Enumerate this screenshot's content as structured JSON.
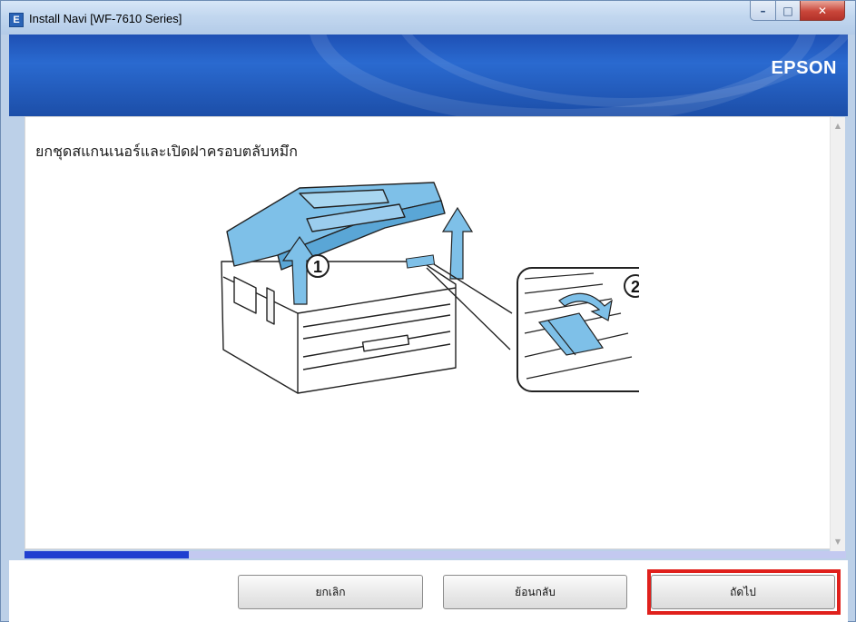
{
  "window": {
    "title": "Install Navi [WF-7610 Series]",
    "app_icon_letter": "E",
    "controls": {
      "minimize": "–",
      "maximize": "□",
      "close": "✕"
    }
  },
  "header": {
    "brand": "EPSON"
  },
  "content": {
    "instruction": "ยกชุดสแกนเนอร์และเปิดฝาครอบตลับหมึก",
    "illustration": {
      "step_1": "1",
      "step_2": "2"
    }
  },
  "progress": {
    "fraction": 0.2
  },
  "footer": {
    "cancel_label": "ยกเลิก",
    "back_label": "ย้อนกลับ",
    "next_label": "ถัดไป"
  },
  "colors": {
    "header_blue": "#1e50b4",
    "progress_fill": "#1f3fd0",
    "progress_track": "#c3c9f0",
    "highlight_red": "#e0201c",
    "printer_lid": "#7ec0e8"
  }
}
